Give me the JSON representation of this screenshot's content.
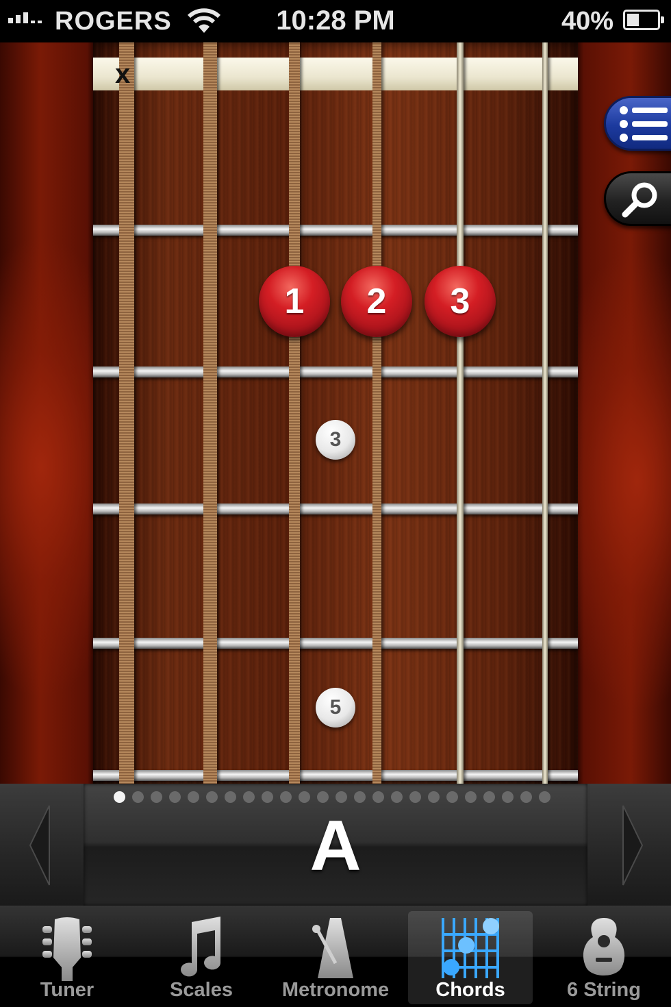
{
  "status_bar": {
    "carrier": "ROGERS",
    "time": "10:28 PM",
    "battery_percent": "40%",
    "battery_level": 0.4,
    "wifi_icon": "wifi-icon",
    "signal_icon": "signal-bars-icon"
  },
  "fretboard": {
    "muted_string_marker": "x",
    "fingers": [
      {
        "label": "1"
      },
      {
        "label": "2"
      },
      {
        "label": "3"
      }
    ],
    "fret_markers": [
      {
        "label": "3"
      },
      {
        "label": "5"
      }
    ]
  },
  "side_buttons": {
    "list_icon": "list-icon",
    "search_icon": "search-icon"
  },
  "chord_selector": {
    "chord_name": "A",
    "page_count": 24,
    "current_page": 1
  },
  "tab_bar": {
    "tabs": [
      {
        "label": "Tuner",
        "icon": "guitar-headstock-icon",
        "active": false
      },
      {
        "label": "Scales",
        "icon": "music-note-icon",
        "active": false
      },
      {
        "label": "Metronome",
        "icon": "metronome-icon",
        "active": false
      },
      {
        "label": "Chords",
        "icon": "chord-diagram-icon",
        "active": true
      },
      {
        "label": "6 String",
        "icon": "acoustic-guitar-icon",
        "active": false
      }
    ]
  },
  "colors": {
    "finger_red": "#d41e24",
    "active_tab_icon": "#3aa8ff",
    "list_button_blue": "#1c3a9e"
  }
}
